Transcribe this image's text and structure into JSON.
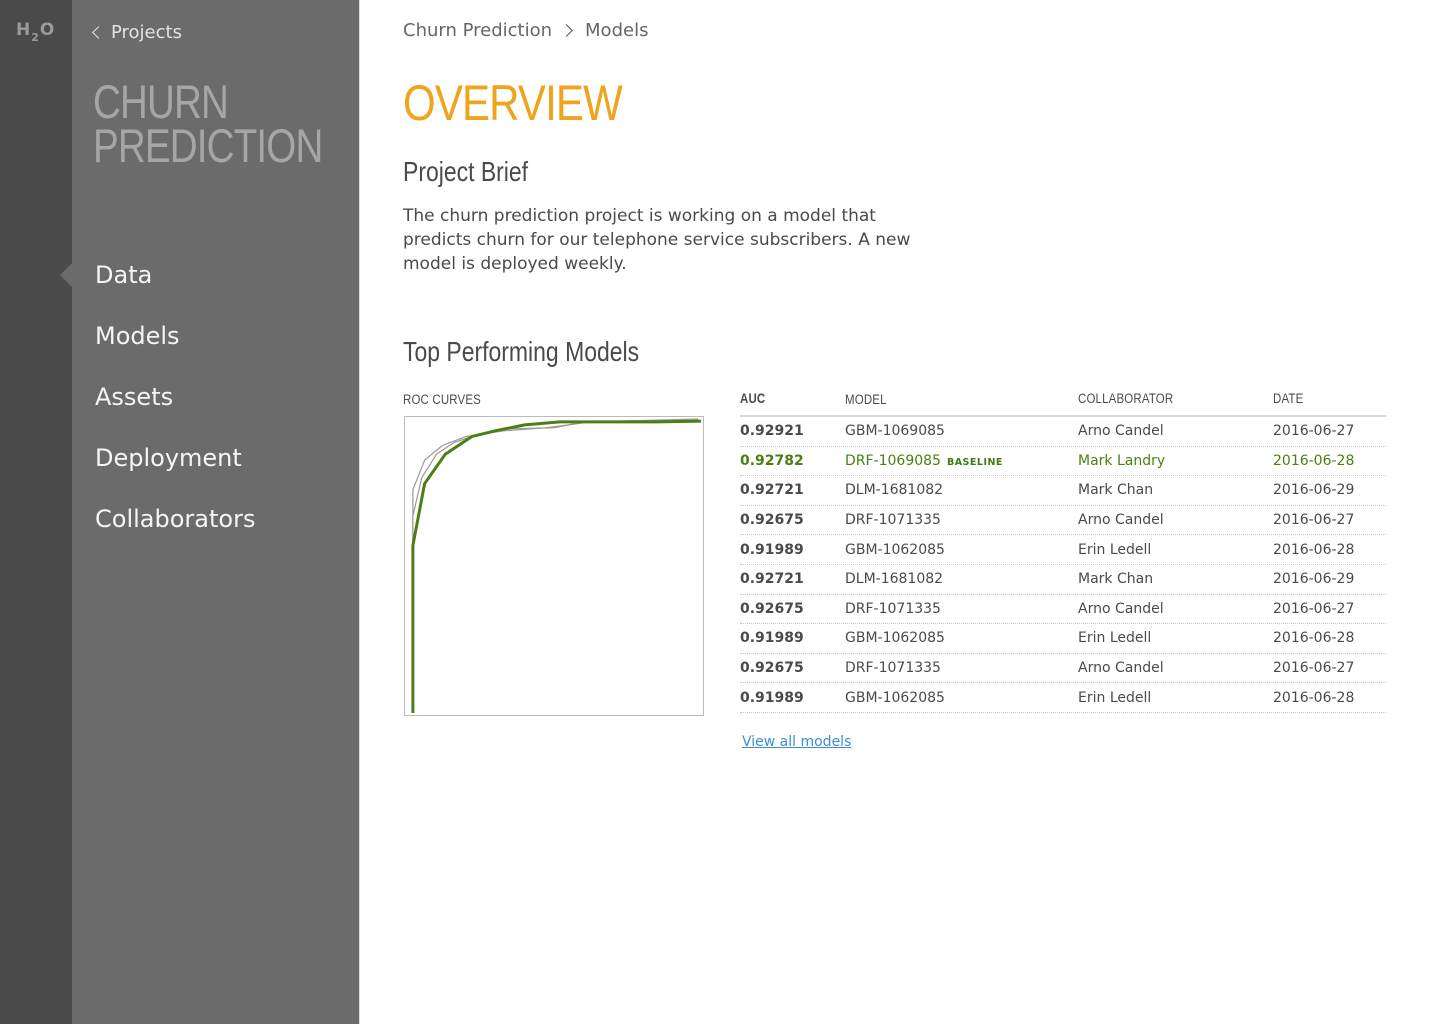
{
  "app": {
    "logo_h": "H",
    "logo_sub": "2",
    "logo_o": "O"
  },
  "sidebar": {
    "back_label": "Projects",
    "project_name": "CHURN\nPREDICTION",
    "items": [
      {
        "label": "Data",
        "active": true
      },
      {
        "label": "Models",
        "active": false
      },
      {
        "label": "Assets",
        "active": false
      },
      {
        "label": "Deployment",
        "active": false
      },
      {
        "label": "Collaborators",
        "active": false
      }
    ]
  },
  "breadcrumb": {
    "project": "Churn Prediction",
    "current": "Models"
  },
  "page": {
    "title": "OVERVIEW",
    "brief_title": "Project Brief",
    "brief_text": "The churn prediction project is working on a model that predicts churn for our telephone service subscribers. A new model is deployed weekly.",
    "models_title": "Top Performing Models",
    "roc_label": "ROC CURVES"
  },
  "table": {
    "headers": {
      "auc": "AUC",
      "model": "MODEL",
      "collaborator": "COLLABORATOR",
      "date": "DATE"
    },
    "baseline_label": "BASELINE",
    "rows": [
      {
        "auc": "0.92921",
        "model": "GBM-1069085",
        "collaborator": "Arno Candel",
        "date": "2016-06-27",
        "baseline": false
      },
      {
        "auc": "0.92782",
        "model": "DRF-1069085",
        "collaborator": "Mark Landry",
        "date": "2016-06-28",
        "baseline": true
      },
      {
        "auc": "0.92721",
        "model": "DLM-1681082",
        "collaborator": "Mark Chan",
        "date": "2016-06-29",
        "baseline": false
      },
      {
        "auc": "0.92675",
        "model": "DRF-1071335",
        "collaborator": "Arno Candel",
        "date": "2016-06-27",
        "baseline": false
      },
      {
        "auc": "0.91989",
        "model": "GBM-1062085",
        "collaborator": "Erin Ledell",
        "date": "2016-06-28",
        "baseline": false
      },
      {
        "auc": "0.92721",
        "model": "DLM-1681082",
        "collaborator": "Mark Chan",
        "date": "2016-06-29",
        "baseline": false
      },
      {
        "auc": "0.92675",
        "model": "DRF-1071335",
        "collaborator": "Arno Candel",
        "date": "2016-06-27",
        "baseline": false
      },
      {
        "auc": "0.91989",
        "model": "GBM-1062085",
        "collaborator": "Erin Ledell",
        "date": "2016-06-28",
        "baseline": false
      },
      {
        "auc": "0.92675",
        "model": "DRF-1071335",
        "collaborator": "Arno Candel",
        "date": "2016-06-27",
        "baseline": false
      },
      {
        "auc": "0.91989",
        "model": "GBM-1062085",
        "collaborator": "Erin Ledell",
        "date": "2016-06-28",
        "baseline": false
      }
    ],
    "view_all": "View all models"
  },
  "colors": {
    "accent": "#f0a31d",
    "baseline": "#4b7f14",
    "link": "#3a8fd6",
    "roc_secondary": "#9a9a9a"
  },
  "roc": {
    "curves": [
      {
        "name": "",
        "highlight": false,
        "points": [
          [
            0.02,
            0.0
          ],
          [
            0.02,
            0.76
          ],
          [
            0.06,
            0.86
          ],
          [
            0.12,
            0.91
          ],
          [
            0.2,
            0.94
          ],
          [
            0.33,
            0.96
          ],
          [
            0.47,
            0.97
          ],
          [
            0.55,
            0.98
          ],
          [
            0.62,
            0.99
          ],
          [
            0.75,
            0.99
          ],
          [
            0.97,
            0.99
          ],
          [
            0.99,
            1.0
          ]
        ]
      },
      {
        "name": "",
        "highlight": false,
        "points": [
          [
            0.02,
            0.0
          ],
          [
            0.02,
            0.67
          ],
          [
            0.05,
            0.8
          ],
          [
            0.1,
            0.88
          ],
          [
            0.16,
            0.92
          ],
          [
            0.25,
            0.95
          ],
          [
            0.35,
            0.967
          ],
          [
            0.5,
            0.97
          ],
          [
            0.6,
            0.99
          ],
          [
            0.8,
            0.995
          ],
          [
            0.99,
            1.0
          ]
        ]
      },
      {
        "name": "",
        "highlight": true,
        "points": [
          [
            0.02,
            0.0
          ],
          [
            0.02,
            0.57
          ],
          [
            0.06,
            0.78
          ],
          [
            0.13,
            0.88
          ],
          [
            0.22,
            0.94
          ],
          [
            0.3,
            0.96
          ],
          [
            0.4,
            0.98
          ],
          [
            0.52,
            0.99
          ],
          [
            0.7,
            0.99
          ],
          [
            0.85,
            0.99
          ],
          [
            1.0,
            0.993
          ]
        ]
      }
    ]
  }
}
